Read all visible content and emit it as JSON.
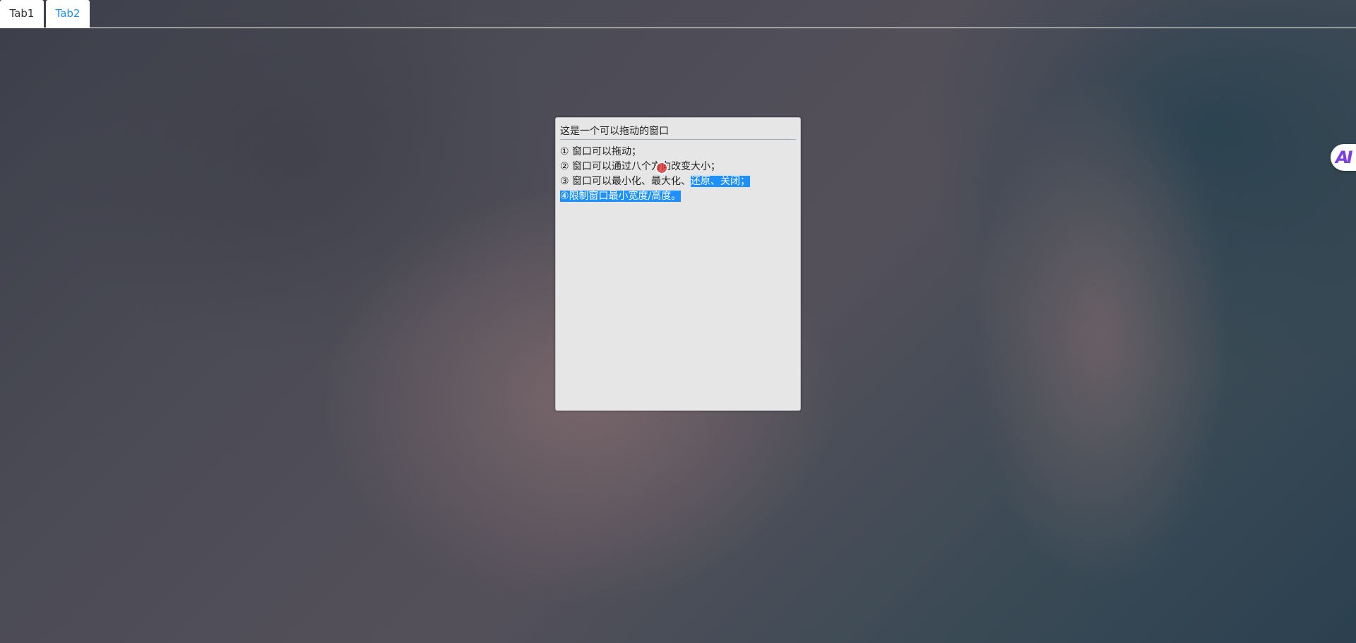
{
  "tabs": [
    {
      "label": "Tab1",
      "active": false
    },
    {
      "label": "Tab2",
      "active": true
    }
  ],
  "window": {
    "title": "这是一个可以拖动的窗口",
    "lines": [
      {
        "num": "①",
        "text": "窗口可以拖动；"
      },
      {
        "num": "②",
        "text": "窗口可以通过八个方向改变大小；"
      },
      {
        "num": "③",
        "text_plain": "窗口可以最小化、最大化、",
        "text_selected": "还原、关闭；"
      },
      {
        "num": "④",
        "text_selected": "限制窗口最小宽度/高度。"
      }
    ]
  },
  "colors": {
    "accent": "#1e90ff",
    "window_bg": "#e6e6e6",
    "selection": "#1e90ff"
  },
  "icons": {
    "side_badge": "ai-assistant-icon",
    "cursor": "cursor-marker-icon"
  },
  "side_badge": {
    "label": "AI"
  }
}
